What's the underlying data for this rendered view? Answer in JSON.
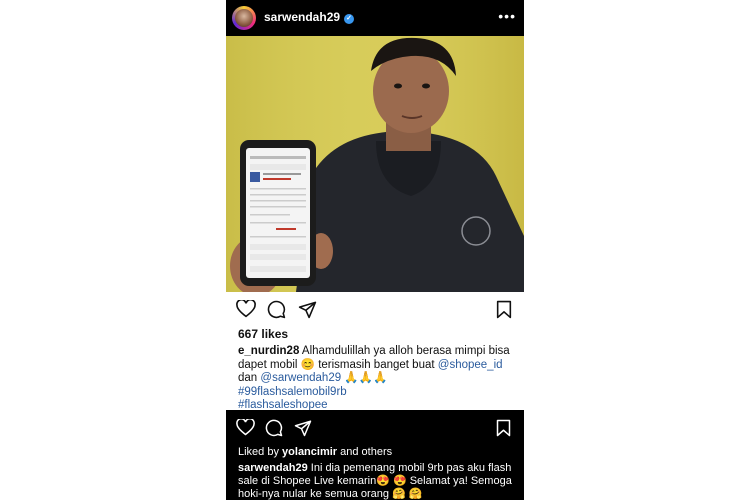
{
  "header": {
    "username": "sarwendah29",
    "verified_icon": "verified-badge-icon",
    "more_icon": "more-options-icon"
  },
  "post_top": {
    "likes": "667 likes",
    "comment": {
      "username": "e_nurdin28",
      "text_part1": "Alhamdulillah ya alloh berasa mimpi bisa dapet mobil",
      "emoji1": "😊",
      "text_part2": "terismasih banget buat",
      "mention1": "@shopee_id",
      "text_part3": "dan",
      "mention2": "@sarwendah29",
      "emoji2": "🙏🙏🙏",
      "hashtag1": "#99flashsalemobil9rb",
      "hashtag2": "#flashsaleshopee"
    }
  },
  "post_bottom": {
    "liked_by_prefix": "Liked by",
    "liked_by_user": "yolancimir",
    "liked_by_suffix": "and others",
    "caption_username": "sarwendah29",
    "caption_text": "Ini dia pemenang mobil 9rb pas aku flash sale di Shopee Live kemarin😍 😍 Selamat ya! Semoga hoki-nya nular ke semua orang 🤗 🤗"
  },
  "colors": {
    "link": "#2a5b9d",
    "photo_bg": "#d8cc55",
    "verified": "#3897f0"
  }
}
